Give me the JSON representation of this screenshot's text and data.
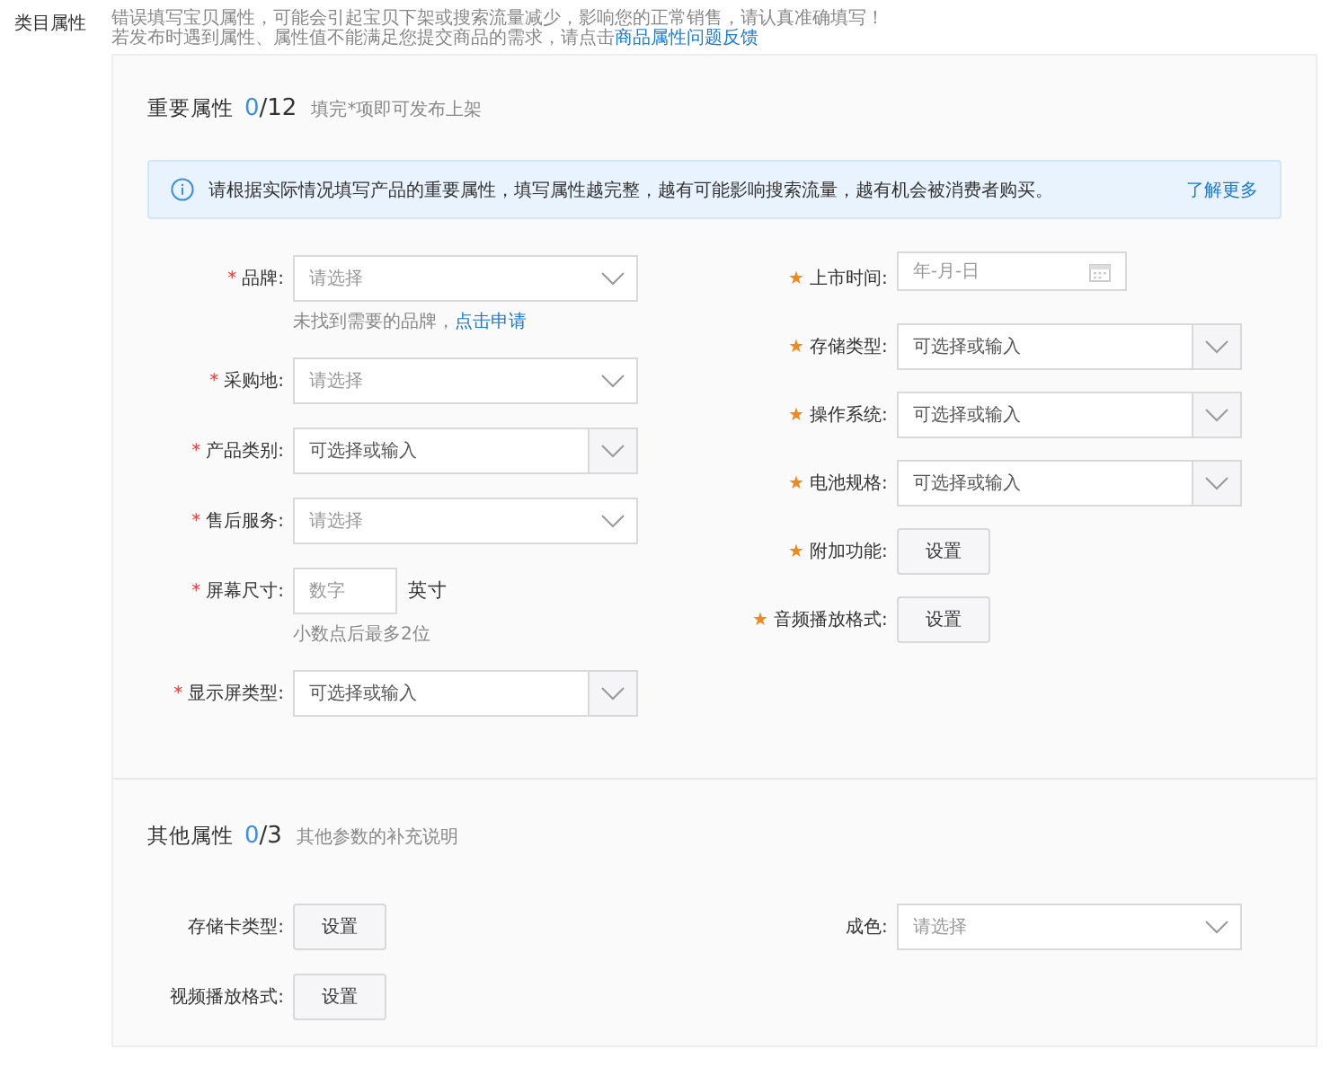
{
  "category": {
    "label": "类目属性",
    "notices": [
      {
        "text": "错误填写宝贝属性，可能会引起宝贝下架或搜索流量减少，影响您的正常销售，请认真准确填写！"
      },
      {
        "text": "若发布时遇到属性、属性值不能满足您提交商品的需求，请点击",
        "link": "商品属性问题反馈"
      }
    ]
  },
  "sections": [
    {
      "title": "重要属性",
      "filled": "0",
      "total": "/12",
      "hint": "填完*项即可发布上架",
      "info": {
        "text": "请根据实际情况填写产品的重要属性，填写属性越完整，越有可能影响搜索流量，越有机会被消费者购买。",
        "link": "了解更多"
      },
      "columns": [
        [
          {
            "label": "品牌:",
            "mark": "*",
            "kind": "select",
            "placeholder": "请选择",
            "help": "未找到需要的品牌，",
            "help_link": "点击申请"
          },
          {
            "label": "采购地:",
            "mark": "*",
            "kind": "select",
            "placeholder": "请选择"
          },
          {
            "label": "产品类别:",
            "mark": "*",
            "kind": "combo",
            "placeholder": "可选择或输入"
          },
          {
            "label": "售后服务:",
            "mark": "*",
            "kind": "select",
            "placeholder": "请选择"
          },
          {
            "label": "屏幕尺寸:",
            "mark": "*",
            "kind": "number",
            "placeholder": "数字",
            "unit": "英寸",
            "help": "小数点后最多2位"
          },
          {
            "label": "显示屏类型:",
            "mark": "*",
            "kind": "combo",
            "placeholder": "可选择或输入"
          }
        ],
        [
          {
            "label": "上市时间:",
            "mark": "★",
            "kind": "date",
            "placeholder": "年-月-日"
          },
          {
            "label": "存储类型:",
            "mark": "★",
            "kind": "combo",
            "placeholder": "可选择或输入"
          },
          {
            "label": "操作系统:",
            "mark": "★",
            "kind": "combo",
            "placeholder": "可选择或输入"
          },
          {
            "label": "电池规格:",
            "mark": "★",
            "kind": "combo",
            "placeholder": "可选择或输入"
          },
          {
            "label": "附加功能:",
            "mark": "★",
            "kind": "button",
            "button": "设置"
          },
          {
            "label": "音频播放格式:",
            "mark": "★",
            "kind": "button",
            "button": "设置"
          }
        ]
      ]
    },
    {
      "title": "其他属性",
      "filled": "0",
      "total": "/3",
      "hint": "其他参数的补充说明",
      "columns": [
        [
          {
            "label": "存储卡类型:",
            "kind": "button",
            "button": "设置"
          },
          {
            "label": "视频播放格式:",
            "kind": "button",
            "button": "设置"
          }
        ],
        [
          {
            "label": "成色:",
            "kind": "select",
            "placeholder": "请选择"
          }
        ]
      ]
    }
  ]
}
